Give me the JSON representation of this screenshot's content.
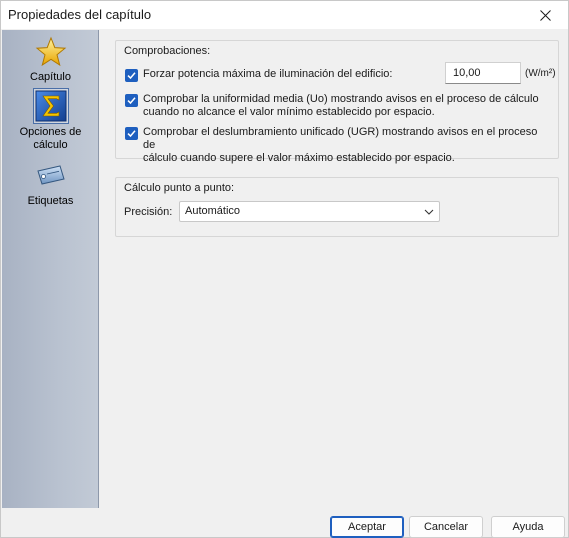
{
  "window": {
    "title": "Propiedades del capítulo"
  },
  "sidebar": {
    "items": [
      {
        "label": "Capítulo",
        "icon": "star-icon"
      },
      {
        "label": "Opciones de cálculo",
        "icon": "sigma-icon",
        "selected": true
      },
      {
        "label": "Etiquetas",
        "icon": "tag-icon"
      }
    ]
  },
  "comprobaciones": {
    "title": "Comprobaciones:",
    "force_power_label": "Forzar potencia máxima de iluminación del edificio:",
    "force_power_checked": true,
    "force_power_value": "10,00",
    "force_power_unit": "(W/m²)",
    "uniformity_label_1": "Comprobar la uniformidad media (Uo) mostrando avisos en el proceso de cálculo",
    "uniformity_label_2": "cuando no alcance el valor mínimo establecido por espacio.",
    "uniformity_checked": true,
    "glare_label_1": "Comprobar el deslumbramiento unificado (UGR) mostrando avisos en el proceso de",
    "glare_label_2": "cálculo cuando supere el valor máximo establecido por espacio.",
    "glare_checked": true
  },
  "point_calc": {
    "title": "Cálculo punto a punto:",
    "precision_label": "Precisión:",
    "precision_value": "Automático"
  },
  "buttons": {
    "accept": "Aceptar",
    "cancel": "Cancelar",
    "help": "Ayuda"
  },
  "colors": {
    "accent": "#1e5fbf",
    "sidebar": "#b9c2d0"
  }
}
